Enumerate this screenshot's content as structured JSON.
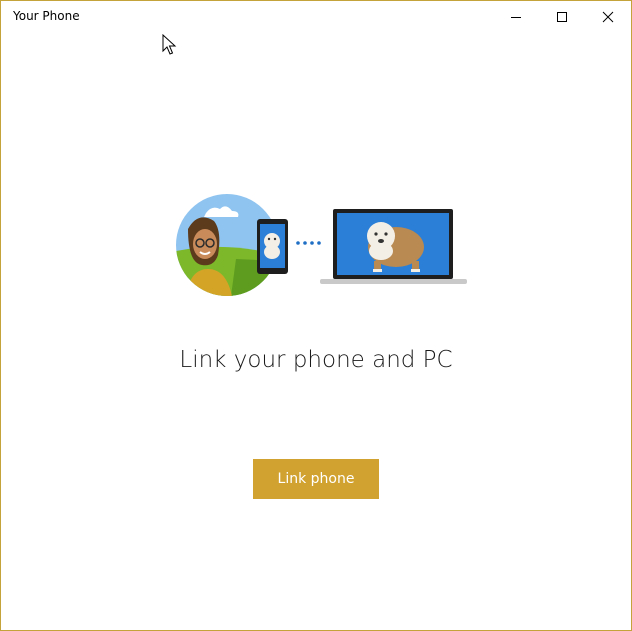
{
  "window": {
    "title": "Your Phone",
    "border_color": "#c3a33a",
    "controls": {
      "minimize": "minimize-icon",
      "maximize": "maximize-icon",
      "close": "close-icon"
    }
  },
  "main": {
    "heading": "Link your phone and PC",
    "button_label": "Link phone",
    "accent_color": "#d1a22f",
    "illustration": {
      "person": "person-avatar-icon",
      "phone": "phone-icon",
      "connection": "dotted-connection-icon",
      "laptop": "laptop-icon"
    }
  }
}
